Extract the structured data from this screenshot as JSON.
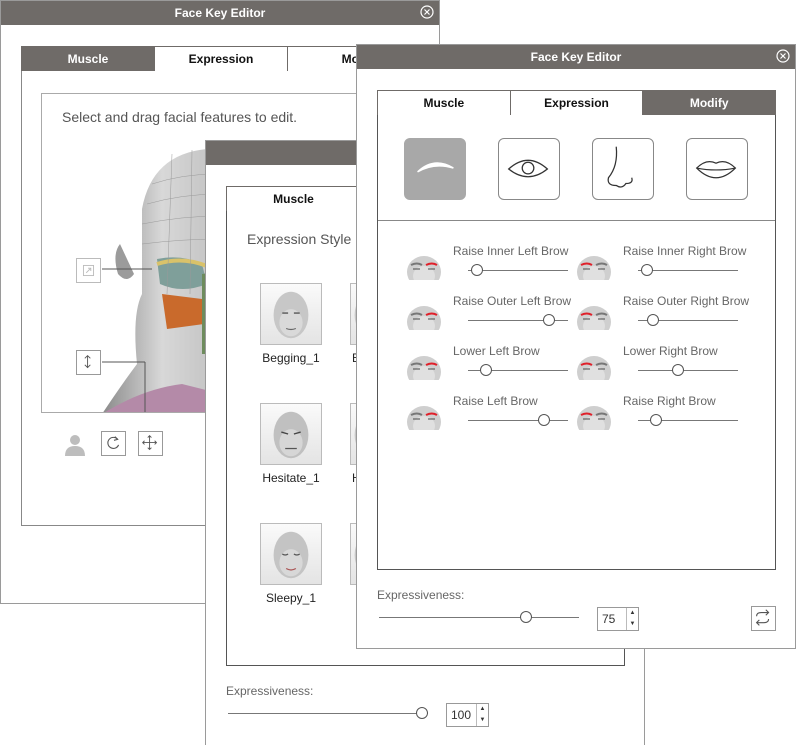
{
  "windows": {
    "back": {
      "title": "Face Key Editor",
      "tabs": [
        "Muscle",
        "Expression",
        "Mod"
      ],
      "active_tab": 0,
      "hint": "Select and drag facial features to edit."
    },
    "middle": {
      "tabs": [
        "Muscle"
      ],
      "heading": "Expression Style",
      "thumbnails": [
        {
          "label": "Begging_1"
        },
        {
          "label": "B"
        },
        {
          "label": "Hesitate_1"
        },
        {
          "label": "H"
        },
        {
          "label": "Sleepy_1"
        },
        {
          "label": ""
        }
      ],
      "expressiveness_label": "Expressiveness:",
      "expressiveness_value": "100",
      "expressiveness_level": 1.0
    },
    "front": {
      "title": "Face Key Editor",
      "tabs": [
        "Muscle",
        "Expression",
        "Modify"
      ],
      "active_tab": 2,
      "features": [
        {
          "icon": "eyebrow-icon",
          "selected": true
        },
        {
          "icon": "eye-icon",
          "selected": false
        },
        {
          "icon": "nose-icon",
          "selected": false
        },
        {
          "icon": "lips-icon",
          "selected": false
        }
      ],
      "sliders": [
        {
          "label": "Raise Inner Left Brow",
          "value": 0.03
        },
        {
          "label": "Raise Inner Right Brow",
          "value": 0.03
        },
        {
          "label": "Raise Outer Left Brow",
          "value": 0.85
        },
        {
          "label": "Raise Outer Right Brow",
          "value": 0.1
        },
        {
          "label": "Lower Left Brow",
          "value": 0.14
        },
        {
          "label": "Lower Right Brow",
          "value": 0.39
        },
        {
          "label": "Raise Left Brow",
          "value": 0.8
        },
        {
          "label": "Raise Right Brow",
          "value": 0.14
        }
      ],
      "expressiveness_label": "Expressiveness:",
      "expressiveness_value": "75",
      "expressiveness_level": 0.75
    }
  },
  "colors": {
    "titlebar": "#6f6b68",
    "selected_feature": "#a8a8a8",
    "brow_highlight": "#e0202a"
  }
}
